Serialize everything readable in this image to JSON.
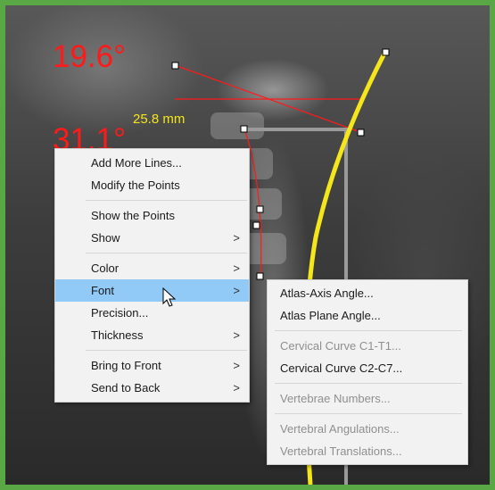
{
  "overlay": {
    "angle_1": "19.6°",
    "angle_2": "31.1°",
    "distance": "25.8 mm"
  },
  "context_menu": {
    "items": [
      {
        "label": "Add More Lines..."
      },
      {
        "label": "Modify the Points"
      },
      {
        "label": "Show the Points"
      },
      {
        "label": "Show"
      },
      {
        "label": "Color"
      },
      {
        "label": "Font"
      },
      {
        "label": "Precision..."
      },
      {
        "label": "Thickness"
      },
      {
        "label": "Bring to Front"
      },
      {
        "label": "Send to Back"
      }
    ],
    "submenu_arrow": ">"
  },
  "font_submenu": {
    "items": [
      {
        "label": "Atlas-Axis Angle..."
      },
      {
        "label": "Atlas Plane Angle..."
      },
      {
        "label": "Cervical Curve C1-T1..."
      },
      {
        "label": "Cervical Curve C2-C7..."
      },
      {
        "label": "Vertebrae Numbers..."
      },
      {
        "label": "Vertebral Angulations..."
      },
      {
        "label": "Vertebral Translations..."
      }
    ]
  },
  "colors": {
    "frame_green": "#5aa845",
    "measure_red": "#ff1a1a",
    "curve_yellow": "#f5e61b",
    "menu_highlight": "#91c9f7"
  },
  "icons": {
    "cursor": "mouse-pointer-icon"
  }
}
